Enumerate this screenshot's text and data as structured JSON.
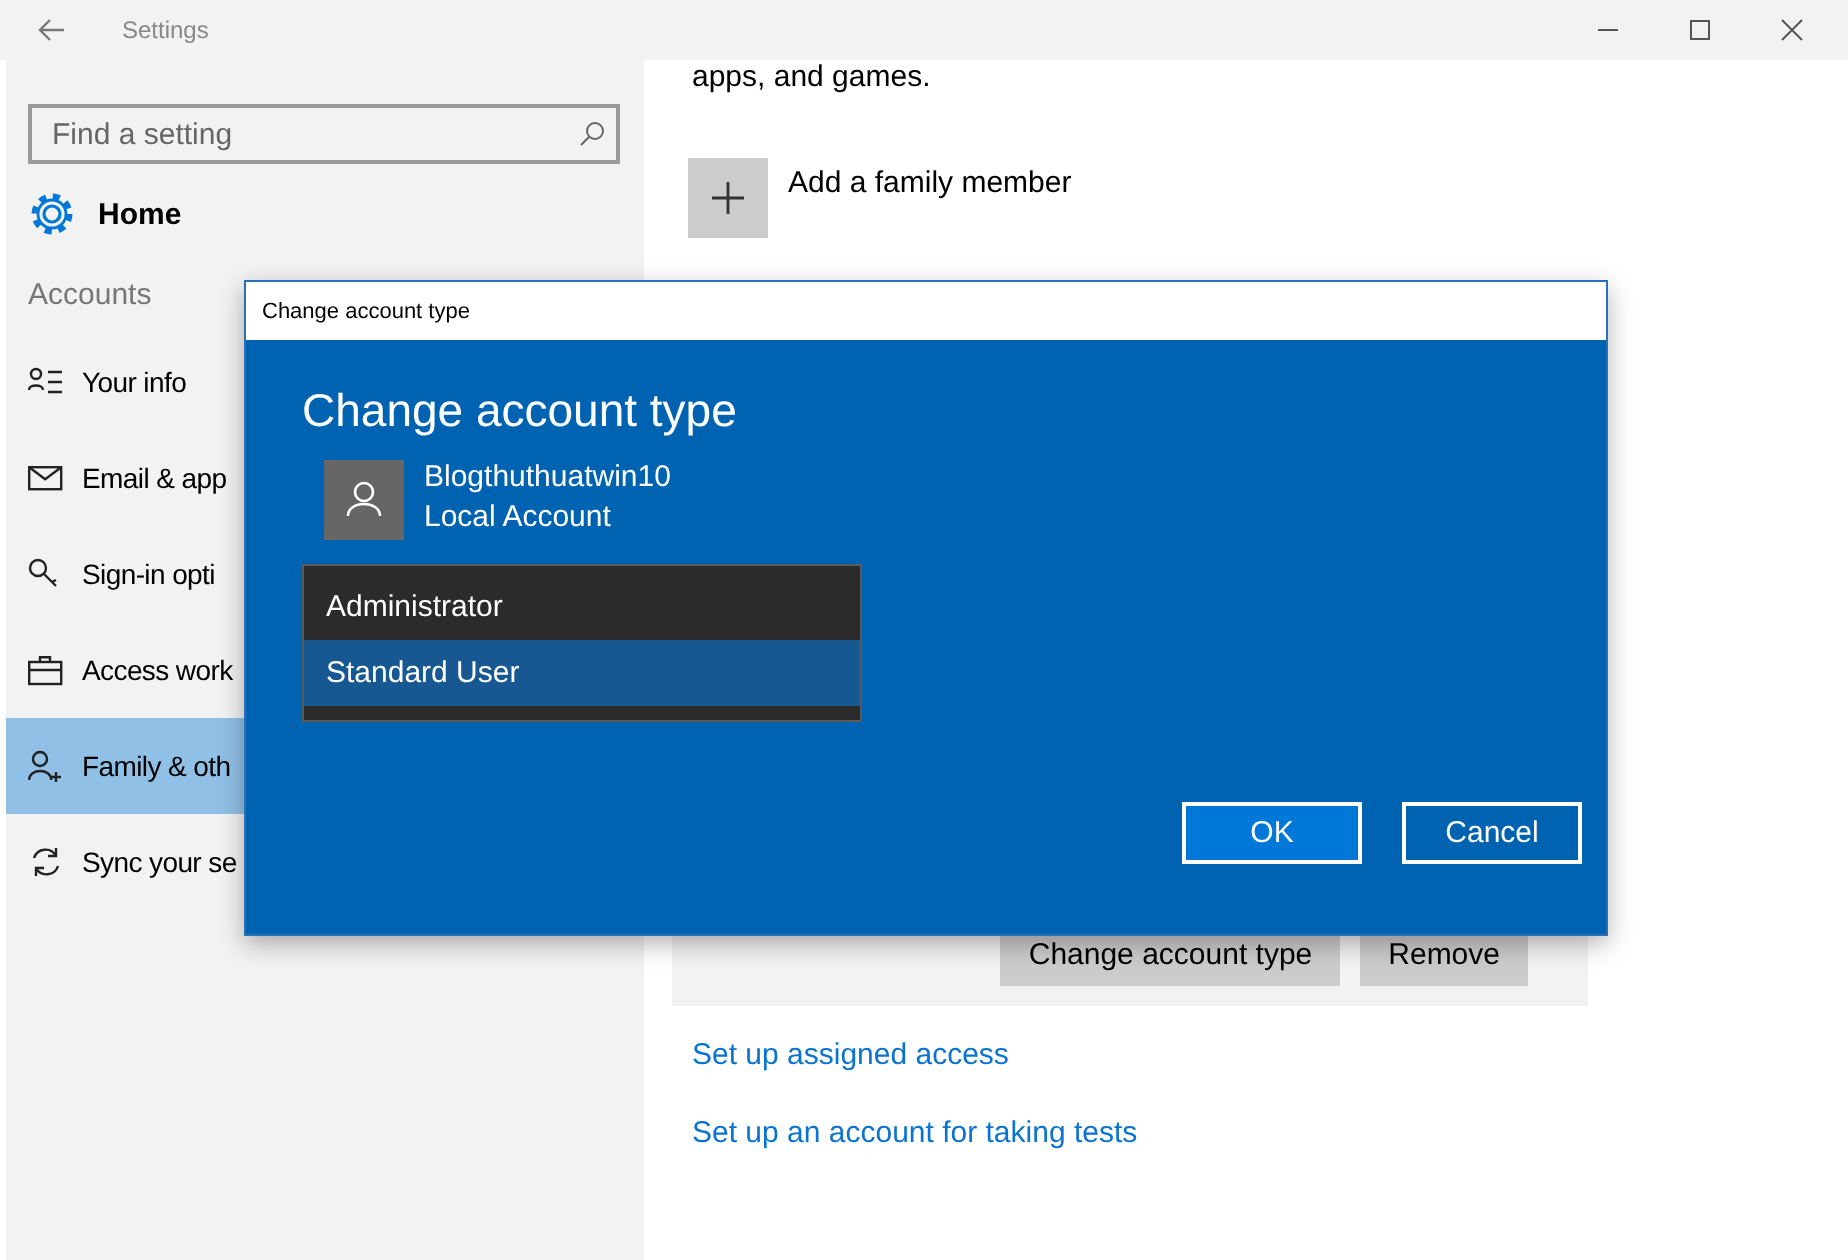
{
  "window": {
    "title": "Settings"
  },
  "sidebar": {
    "search": {
      "placeholder": "Find a setting"
    },
    "home": "Home",
    "section": "Accounts",
    "items": [
      {
        "label": "Your info",
        "kind": "info",
        "selected": false
      },
      {
        "label": "Email & app",
        "kind": "mail",
        "selected": false
      },
      {
        "label": "Sign-in opti",
        "kind": "key",
        "selected": false
      },
      {
        "label": "Access work",
        "kind": "briefcase",
        "selected": false
      },
      {
        "label": "Family & oth",
        "kind": "family",
        "selected": true
      },
      {
        "label": "Sync your se",
        "kind": "sync",
        "selected": false
      }
    ]
  },
  "main": {
    "intro_tail": "apps, and games.",
    "add_member": "Add a family member",
    "account_buttons": [
      "Change account type",
      "Remove"
    ],
    "links": [
      "Set up assigned access",
      "Set up an account for taking tests"
    ]
  },
  "dialog": {
    "title": "Change account type",
    "heading": "Change account type",
    "account": {
      "name": "Blogthuthuatwin10",
      "type": "Local Account"
    },
    "options": [
      {
        "label": "Administrator",
        "selected": false
      },
      {
        "label": "Standard User",
        "selected": true
      }
    ],
    "buttons": [
      {
        "label": "OK",
        "kind": "primary"
      },
      {
        "label": "Cancel",
        "kind": "secondary"
      }
    ]
  }
}
